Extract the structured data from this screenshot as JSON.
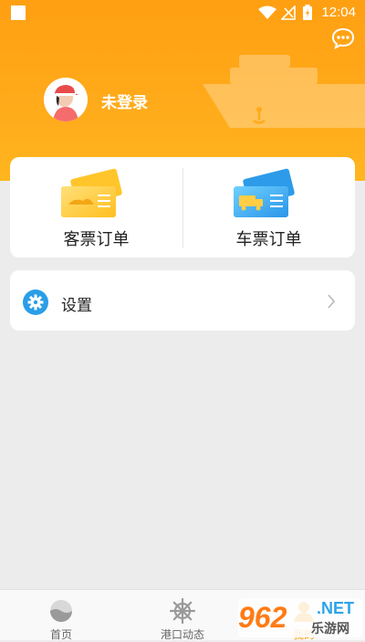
{
  "status_bar": {
    "time": "12:04"
  },
  "profile": {
    "username": "未登录"
  },
  "orders": [
    {
      "label": "客票订单",
      "icon": "passenger-ticket-icon",
      "color": "#ffc52a"
    },
    {
      "label": "车票订单",
      "icon": "vehicle-ticket-icon",
      "color": "#30a9f0"
    }
  ],
  "settings": {
    "label": "设置",
    "icon": "gear-icon"
  },
  "bottom_nav": [
    {
      "label": "首页",
      "icon": "home-icon"
    },
    {
      "label": "港口动态",
      "icon": "ship-wheel-icon"
    },
    {
      "label": "我的",
      "icon": "profile-icon",
      "active": true
    }
  ],
  "watermark": {
    "brand": "962",
    "domain": ".NET",
    "name": "乐游网"
  },
  "colors": {
    "accent": "#ff9f12",
    "blue": "#2a9ee8"
  }
}
